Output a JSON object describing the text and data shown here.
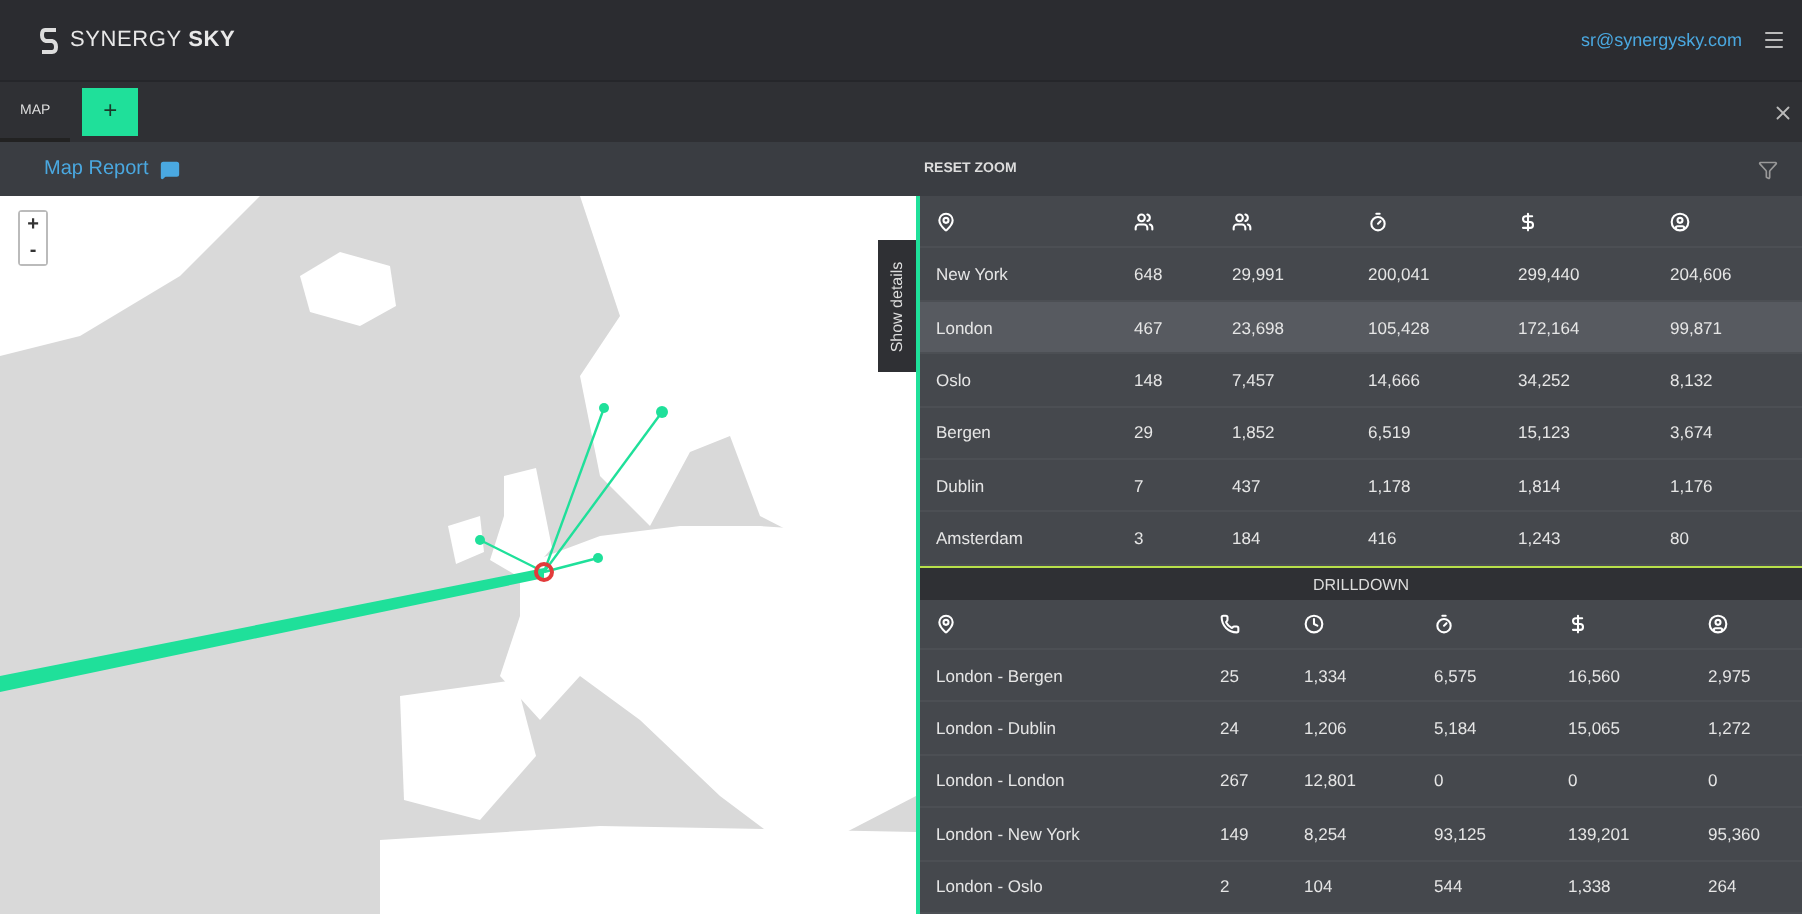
{
  "header": {
    "logo": "SYNERGY **SKY**",
    "user_email": "sr@synergysky.com"
  },
  "tabs": [
    {
      "label": "MAP",
      "selected": true
    },
    {
      "label": "+",
      "selected": false
    }
  ],
  "report": {
    "title": "Map Report",
    "reset_zoom": "RESET ZOOM"
  },
  "map": {
    "kind": "picture",
    "zoom_in": "+",
    "zoom_out": "-",
    "show_details": "Show details"
  },
  "locations": {
    "rows": [
      {
        "cells": [
          "New York",
          "648",
          "29,991",
          "200,041",
          "299,440",
          "204,606"
        ],
        "selected": false
      },
      {
        "cells": [
          "London",
          "467",
          "23,698",
          "105,428",
          "172,164",
          "99,871"
        ],
        "selected": true
      },
      {
        "cells": [
          "Oslo",
          "148",
          "7,457",
          "14,666",
          "34,252",
          "8,132"
        ],
        "selected": false
      },
      {
        "cells": [
          "Bergen",
          "29",
          "1,852",
          "6,519",
          "15,123",
          "3,674"
        ],
        "selected": false
      },
      {
        "cells": [
          "Dublin",
          "7",
          "437",
          "1,178",
          "1,814",
          "1,176"
        ],
        "selected": false
      },
      {
        "cells": [
          "Amsterdam",
          "3",
          "184",
          "416",
          "1,243",
          "80"
        ],
        "selected": false
      }
    ]
  },
  "drilldown": {
    "title": "DRILLDOWN",
    "rows": [
      {
        "cells": [
          "London - Bergen",
          "25",
          "1,334",
          "6,575",
          "16,560",
          "2,975"
        ]
      },
      {
        "cells": [
          "London - Dublin",
          "24",
          "1,206",
          "5,184",
          "15,065",
          "1,272"
        ]
      },
      {
        "cells": [
          "London - London",
          "267",
          "12,801",
          "0",
          "0",
          "0"
        ]
      },
      {
        "cells": [
          "London - New York",
          "149",
          "8,254",
          "93,125",
          "139,201",
          "95,360"
        ]
      },
      {
        "cells": [
          "London - Oslo",
          "2",
          "104",
          "544",
          "1,338",
          "264"
        ]
      }
    ]
  }
}
